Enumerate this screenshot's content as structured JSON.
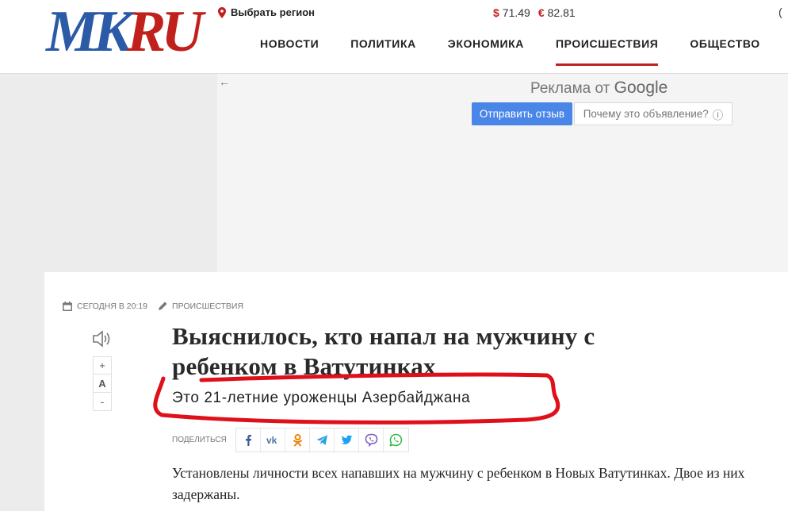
{
  "header": {
    "logo_text": "MKRU",
    "region_label": "Выбрать регион",
    "currency": [
      {
        "symbol": "$",
        "value": "71.49"
      },
      {
        "symbol": "€",
        "value": "82.81"
      }
    ],
    "edge_char": "(",
    "nav": [
      {
        "label": "НОВОСТИ",
        "active": false
      },
      {
        "label": "ПОЛИТИКА",
        "active": false
      },
      {
        "label": "ЭКОНОМИКА",
        "active": false
      },
      {
        "label": "ПРОИСШЕСТВИЯ",
        "active": true
      },
      {
        "label": "ОБЩЕСТВО",
        "active": false
      }
    ]
  },
  "ad": {
    "back_arrow": "←",
    "title_prefix": "Реклама от ",
    "title_brand": "Google",
    "send_feedback": "Отправить отзыв",
    "why_ad": "Почему это объявление?",
    "info_symbol": "ⓘ"
  },
  "article": {
    "date": "сегодня в 20:19",
    "rubric": "происшествия",
    "font_controls": [
      "+",
      "A",
      "-"
    ],
    "headline": "Выяснилось, кто напал на мужчину с ребенком в Ватутинках",
    "subheadline": "Это 21-летние уроженцы Азербайджана",
    "share_label": "поделиться",
    "share_icons": [
      "facebook-icon",
      "vk-icon",
      "odnoklassniki-icon",
      "telegram-icon",
      "twitter-icon",
      "viber-icon",
      "whatsapp-icon"
    ],
    "body": "Установлены личности всех напавших на мужчину с ребенком в Новых Ватутинках. Двое из них задержаны."
  },
  "colors": {
    "brand_red": "#c0211c",
    "logo_blue": "#2b5aa6",
    "ad_button_blue": "#4a86e8",
    "highlight_red": "#e0101a"
  }
}
